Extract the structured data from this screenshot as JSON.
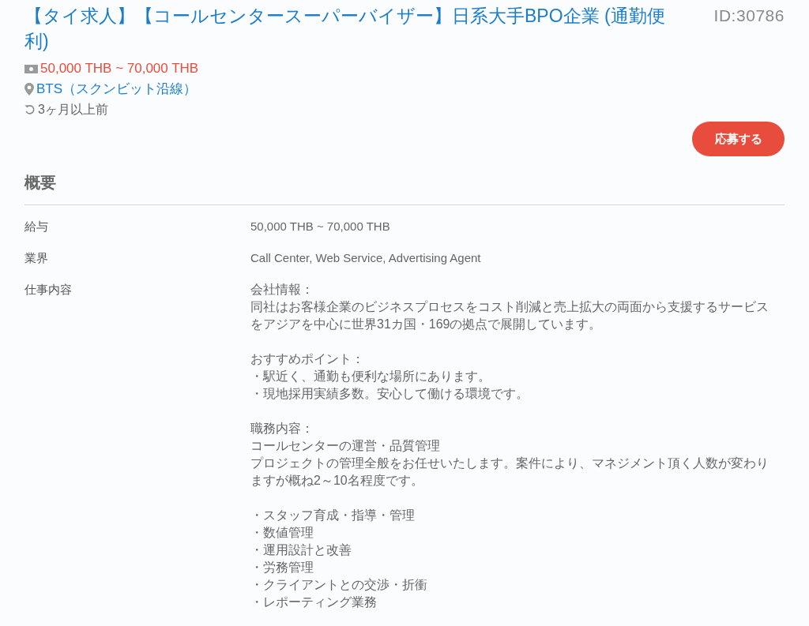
{
  "job": {
    "title": "【タイ求人】【コールセンタースーパーバイザー】日系大手BPO企業 (通勤便利)",
    "id": "ID:30786",
    "salary": "50,000 THB ~ 70,000 THB",
    "location": "BTS（スクンビット沿線）",
    "posted": "3ヶ月以上前",
    "apply_button": "応募する"
  },
  "overview": {
    "heading": "概要",
    "rows": [
      {
        "label": "給与",
        "value": [
          "50,000 THB ~ 70,000 THB"
        ]
      },
      {
        "label": "業界",
        "value": [
          "Call Center, Web Service, Advertising Agent"
        ]
      },
      {
        "label": "仕事内容",
        "paragraphs": [
          [
            "会社情報：",
            "同社はお客様企業のビジネスプロセスをコスト削減と売上拡大の両面から支援するサービスをアジアを中心に世界31カ国・169の拠点で展開しています。"
          ],
          [
            "おすすめポイント：",
            "・駅近く、通勤も便利な場所にあります。",
            "・現地採用実績多数。安心して働ける環境です。"
          ],
          [
            "職務内容：",
            "コールセンターの運営・品質管理",
            "プロジェクトの管理全般をお任せいたします。案件により、マネジメント頂く人数が変わりますが概ね2～10名程度です。"
          ],
          [
            "・スタッフ育成・指導・管理",
            "・数値管理",
            "・運用設計と改善",
            "・労務管理",
            "・クライアントとの交渉・折衝",
            "・レポーティング業務"
          ]
        ]
      }
    ]
  }
}
